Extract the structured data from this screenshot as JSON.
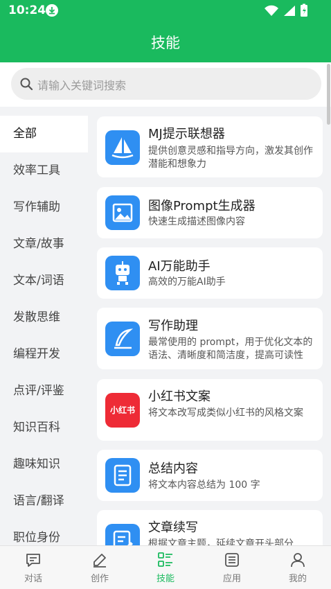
{
  "status_bar": {
    "time": "10:24"
  },
  "header": {
    "title": "技能"
  },
  "search": {
    "placeholder": "请输入关键词搜索"
  },
  "sidebar": {
    "items": [
      {
        "label": "全部",
        "active": true
      },
      {
        "label": "效率工具"
      },
      {
        "label": "写作辅助"
      },
      {
        "label": "文章/故事"
      },
      {
        "label": "文本/词语"
      },
      {
        "label": "发散思维"
      },
      {
        "label": "编程开发"
      },
      {
        "label": "点评/评鉴"
      },
      {
        "label": "知识百科"
      },
      {
        "label": "趣味知识"
      },
      {
        "label": "语言/翻译"
      },
      {
        "label": "职位身份"
      }
    ]
  },
  "skills": [
    {
      "title": "MJ提示联想器",
      "desc": "提供创意灵感和指导方向，激发其创作潜能和想象力",
      "icon": "sailboat-icon"
    },
    {
      "title": "图像Prompt生成器",
      "desc": "快速生成描述图像内容",
      "icon": "image-icon"
    },
    {
      "title": "AI万能助手",
      "desc": "高效的万能AI助手",
      "icon": "robot-icon"
    },
    {
      "title": "写作助理",
      "desc": "最常使用的 prompt，用于优化文本的语法、清晰度和简洁度，提高可读性",
      "icon": "quill-icon"
    },
    {
      "title": "小红书文案",
      "desc": "将文本改写成类似小红书的风格文案",
      "icon": "xiaohongshu-icon",
      "icon_text": "小红书"
    },
    {
      "title": "总结内容",
      "desc": "将文本内容总结为 100 字",
      "icon": "document-icon"
    },
    {
      "title": "文章续写",
      "desc": "根据文章主题，延续文章开头部分",
      "icon": "edit-doc-icon"
    }
  ],
  "tabbar": {
    "tabs": [
      {
        "label": "对话",
        "icon": "chat-icon"
      },
      {
        "label": "创作",
        "icon": "pen-icon"
      },
      {
        "label": "技能",
        "icon": "skills-icon",
        "active": true
      },
      {
        "label": "应用",
        "icon": "apps-icon"
      },
      {
        "label": "我的",
        "icon": "profile-icon"
      }
    ]
  },
  "colors": {
    "brand": "#1aba5e",
    "icon_blue": "#2f8ff2",
    "xiaohongshu": "#ee2b36"
  }
}
